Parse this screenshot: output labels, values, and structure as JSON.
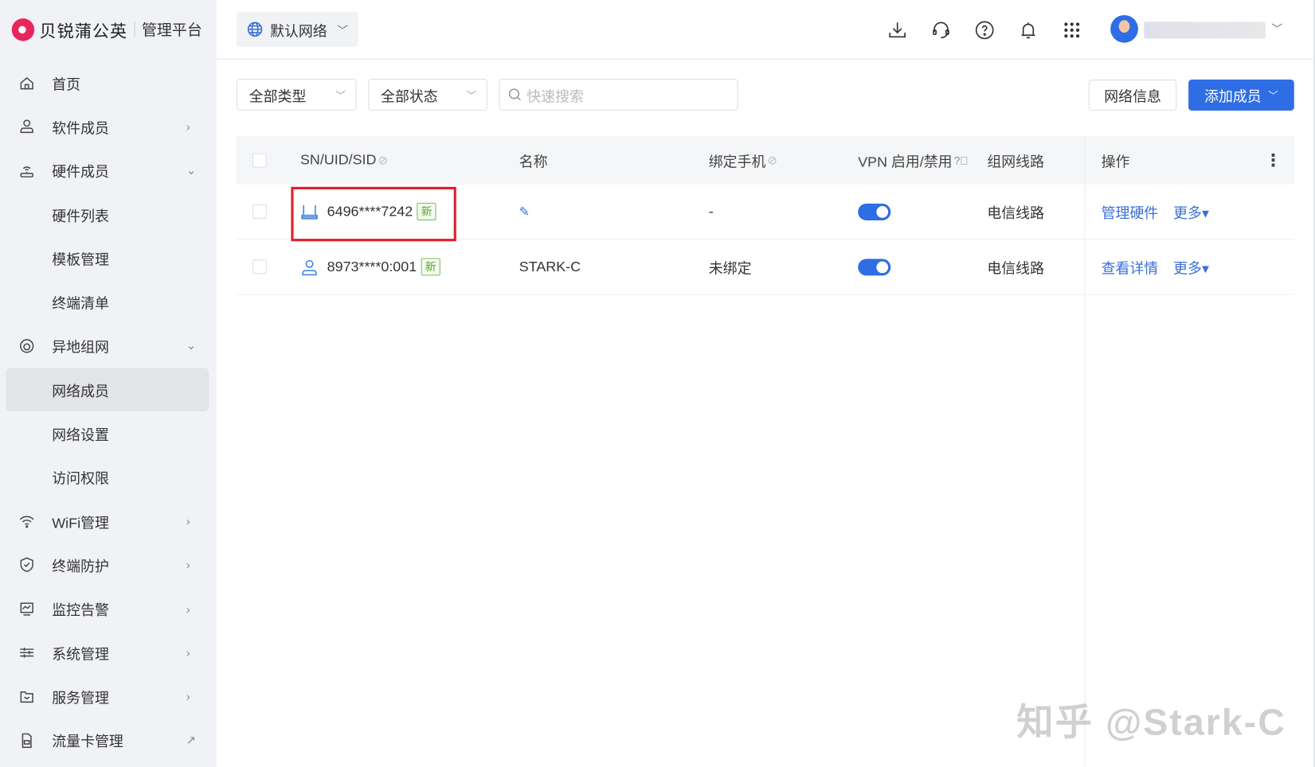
{
  "brand": {
    "name": "贝锐蒲公英",
    "subtitle": "管理平台",
    "accent": "#2f6de5"
  },
  "topbar": {
    "network": "默认网络",
    "icons": [
      "download-icon",
      "headset-icon",
      "help-icon",
      "bell-icon",
      "apps-grid-icon"
    ]
  },
  "sidebar": {
    "items": [
      {
        "label": "首页",
        "icon": "home-icon",
        "arrow": ""
      },
      {
        "label": "软件成员",
        "icon": "user-icon",
        "arrow": "›"
      },
      {
        "label": "硬件成员",
        "icon": "router-icon",
        "arrow": "⌄"
      },
      {
        "label": "硬件列表",
        "icon": "",
        "arrow": ""
      },
      {
        "label": "模板管理",
        "icon": "",
        "arrow": ""
      },
      {
        "label": "终端清单",
        "icon": "",
        "arrow": ""
      },
      {
        "label": "异地组网",
        "icon": "network-icon",
        "arrow": "⌄"
      },
      {
        "label": "网络成员",
        "icon": "",
        "arrow": "",
        "active": true
      },
      {
        "label": "网络设置",
        "icon": "",
        "arrow": ""
      },
      {
        "label": "访问权限",
        "icon": "",
        "arrow": ""
      },
      {
        "label": "WiFi管理",
        "icon": "wifi-icon",
        "arrow": "›"
      },
      {
        "label": "终端防护",
        "icon": "shield-icon",
        "arrow": "›"
      },
      {
        "label": "监控告警",
        "icon": "monitor-icon",
        "arrow": "›"
      },
      {
        "label": "系统管理",
        "icon": "sliders-icon",
        "arrow": "›"
      },
      {
        "label": "服务管理",
        "icon": "folder-icon",
        "arrow": "›"
      },
      {
        "label": "流量卡管理",
        "icon": "sim-card-icon",
        "arrow": "↗"
      }
    ]
  },
  "filters": {
    "type": "全部类型",
    "status": "全部状态",
    "search_placeholder": "快速搜索"
  },
  "actions": {
    "network_info": "网络信息",
    "add_member": "添加成员"
  },
  "table": {
    "headers": {
      "id": "SN/UID/SID",
      "name": "名称",
      "phone": "绑定手机",
      "vpn": "VPN 启用/禁用",
      "line": "组网线路",
      "ops": "操作"
    },
    "rows": [
      {
        "id": "6496****7242",
        "tag": "新",
        "name": "",
        "phone": "-",
        "vpn": true,
        "line": "电信线路",
        "op1": "管理硬件",
        "op2": "更多▾"
      },
      {
        "id": "8973****0:001",
        "tag": "新",
        "name": "STARK-C",
        "phone": "未绑定",
        "vpn": true,
        "line": "电信线路",
        "op1": "查看详情",
        "op2": "更多▾"
      }
    ]
  },
  "watermark": "知乎 @Stark-C"
}
